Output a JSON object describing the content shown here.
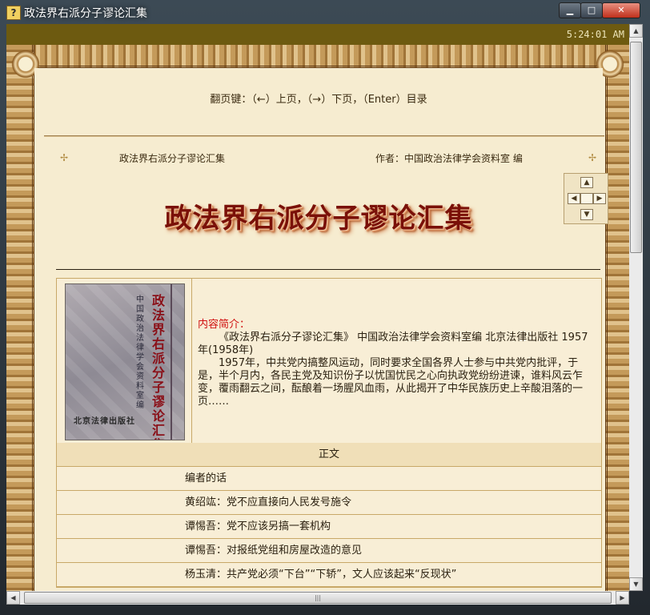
{
  "window": {
    "title": "政法界右派分子谬论汇集",
    "icon": "help-book-icon",
    "controls": {
      "minimize": "▁",
      "maximize": "□",
      "close": "✕"
    }
  },
  "status": {
    "clock": "5:24:01 AM"
  },
  "hint": "翻页键：（←）上页，（→）下页，（Enter）目录",
  "infobar": {
    "book_title": "政法界右派分子谬论汇集",
    "author": "作者：中国政治法律学会资料室 编",
    "ornament": "✢"
  },
  "nav": {
    "up": "▲",
    "left": "◀",
    "right": "▶",
    "down": "▼"
  },
  "main_title": "政法界右派分子谬论汇集",
  "cover": {
    "title": "政法界右派分子谬论汇集",
    "editor": "中国政治法律学会资料室编",
    "publisher": "北京法律出版社"
  },
  "intro": {
    "label": "内容简介：",
    "line1": "《政法界右派分子谬论汇集》 中国政治法律学会资料室编 北京法律出版社 1957年(1958年)",
    "line2": "1957年，中共党内搞整风运动，同时要求全国各界人士参与中共党内批评，于是，半个月内，各民主党及知识份子以忧国忧民之心向执政党纷纷进谏，谁料风云乍变，覆雨翻云之间，酝酿着一场腥风血雨，从此揭开了中华民族历史上辛酸泪落的一页……"
  },
  "toc": {
    "header": "正文",
    "items": [
      "编者的话",
      "黄绍竑：党不应直接向人民发号施令",
      "谭惕吾：党不应该另搞一套机构",
      "谭惕吾：对报纸党组和房屋改造的意见",
      "杨玉清：共产党必须“下台”“下轿”，文人应该起来“反现状”"
    ]
  },
  "scroll": {
    "up": "▲",
    "down": "▼",
    "left": "◀",
    "right": "▶",
    "grip": "|||"
  }
}
